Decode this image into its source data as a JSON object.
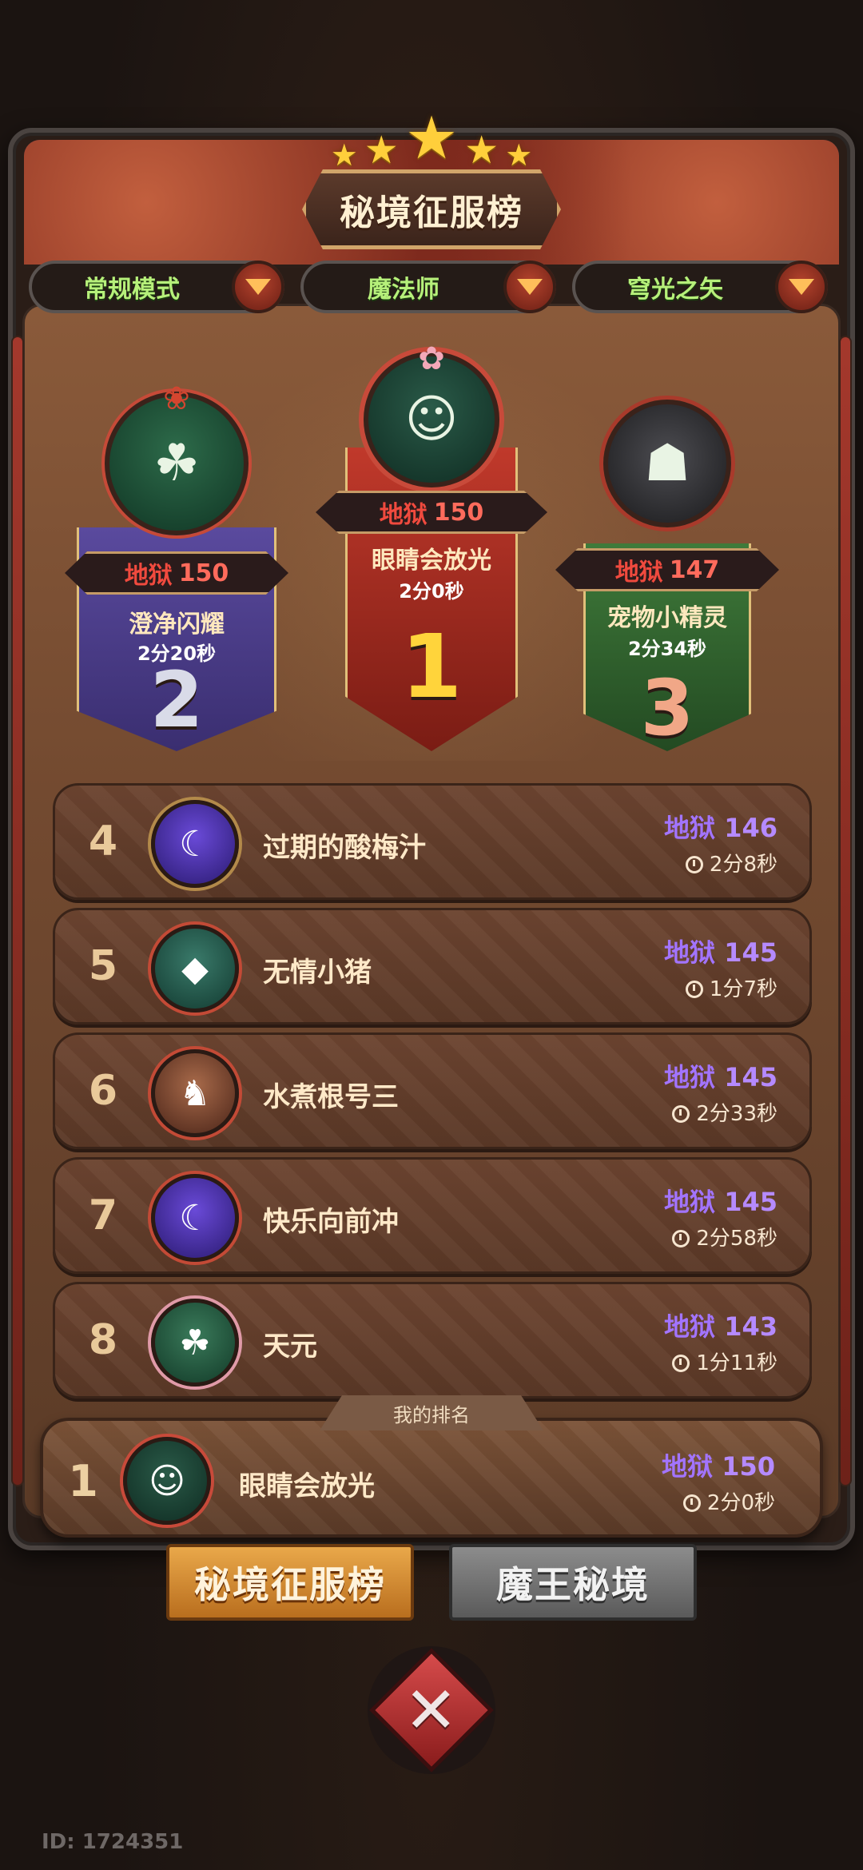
{
  "header": {
    "title": "秘境征服榜",
    "star_count": 5
  },
  "filters": [
    {
      "label": "常规模式"
    },
    {
      "label": "魔法师"
    },
    {
      "label": "穹光之矢"
    }
  ],
  "podium": [
    {
      "rank": "2",
      "difficulty": "地狱",
      "level": "150",
      "name": "澄净闪耀",
      "time": "2分20秒"
    },
    {
      "rank": "1",
      "difficulty": "地狱",
      "level": "150",
      "name": "眼睛会放光",
      "time": "2分0秒"
    },
    {
      "rank": "3",
      "difficulty": "地狱",
      "level": "147",
      "name": "宠物小精灵",
      "time": "2分34秒"
    }
  ],
  "ranking_rows": [
    {
      "rank": "4",
      "name": "过期的酸梅汁",
      "difficulty": "地狱",
      "level": "146",
      "time": "2分8秒"
    },
    {
      "rank": "5",
      "name": "无情小猪",
      "difficulty": "地狱",
      "level": "145",
      "time": "1分7秒"
    },
    {
      "rank": "6",
      "name": "水煮根号三",
      "difficulty": "地狱",
      "level": "145",
      "time": "2分33秒"
    },
    {
      "rank": "7",
      "name": "快乐向前冲",
      "difficulty": "地狱",
      "level": "145",
      "time": "2分58秒"
    },
    {
      "rank": "8",
      "name": "天元",
      "difficulty": "地狱",
      "level": "143",
      "time": "1分11秒"
    }
  ],
  "my_rank": {
    "label": "我的排名",
    "rank": "1",
    "name": "眼睛会放光",
    "difficulty": "地狱",
    "level": "150",
    "time": "2分0秒"
  },
  "bottom_tabs": [
    {
      "label": "秘境征服榜",
      "active": true
    },
    {
      "label": "魔王秘境",
      "active": false
    }
  ],
  "footer": {
    "player_id": "ID: 1724351"
  },
  "colors": {
    "difficulty_podium": "#f04a3e",
    "difficulty_list": "#a274ff",
    "filter_text": "#b6f07a",
    "active_tab": "#e9a84a"
  }
}
